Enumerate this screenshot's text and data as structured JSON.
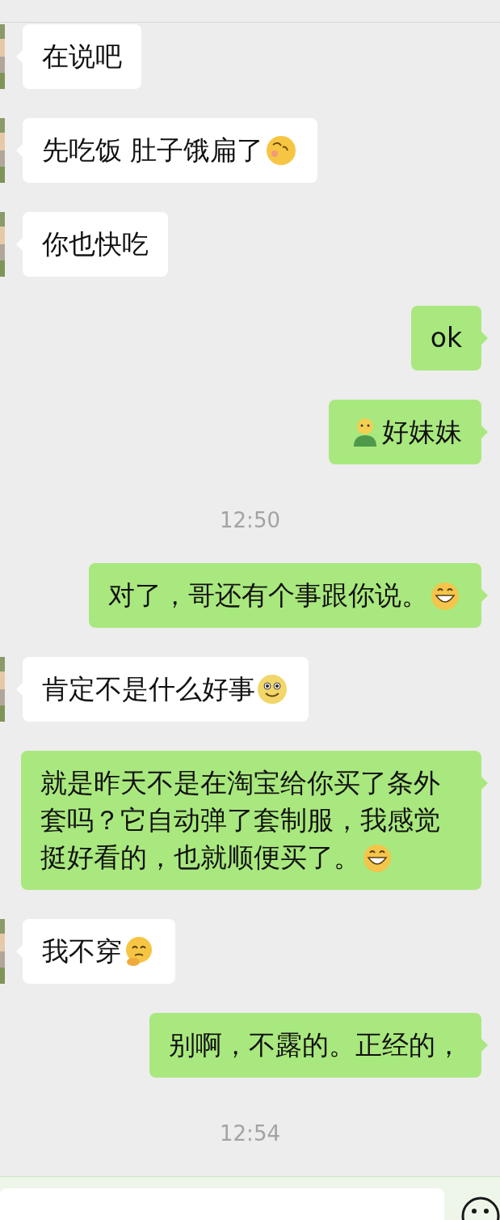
{
  "messages": [
    {
      "kind": "incoming",
      "parts": [
        {
          "kind": "text",
          "text": "在说吧"
        }
      ]
    },
    {
      "kind": "incoming",
      "parts": [
        {
          "kind": "text",
          "text": "先吃饭 肚子饿扁了"
        },
        {
          "kind": "sleepy"
        }
      ]
    },
    {
      "kind": "incoming",
      "parts": [
        {
          "kind": "text",
          "text": "你也快吃"
        }
      ]
    },
    {
      "kind": "outgoing",
      "parts": [
        {
          "kind": "text",
          "text": "ok"
        }
      ]
    },
    {
      "kind": "outgoing",
      "parts": [
        {
          "kind": "figure"
        },
        {
          "kind": "text",
          "text": "好妹妹"
        }
      ]
    },
    {
      "kind": "time",
      "text": "12:50"
    },
    {
      "kind": "outgoing",
      "parts": [
        {
          "kind": "text",
          "text": "对了，哥还有个事跟你说。"
        },
        {
          "kind": "grin"
        }
      ]
    },
    {
      "kind": "incoming",
      "parts": [
        {
          "kind": "text",
          "text": "肯定不是什么好事"
        },
        {
          "kind": "smile"
        }
      ]
    },
    {
      "kind": "outgoing",
      "parts": [
        {
          "kind": "text",
          "text": "就是昨天不是在淘宝给你买了条外"
        },
        {
          "kind": "text",
          "text": "套吗？它自动弹了套制服，我感觉"
        },
        {
          "kind": "text",
          "text": "挺好看的，也就顺便买了。"
        },
        {
          "kind": "grin"
        }
      ]
    },
    {
      "kind": "incoming",
      "parts": [
        {
          "kind": "text",
          "text": "我不穿"
        },
        {
          "kind": "think"
        }
      ]
    },
    {
      "kind": "outgoing",
      "parts": [
        {
          "kind": "text",
          "text": "别啊，不露的。正经的，"
        }
      ]
    },
    {
      "kind": "time",
      "text": "12:54"
    }
  ]
}
